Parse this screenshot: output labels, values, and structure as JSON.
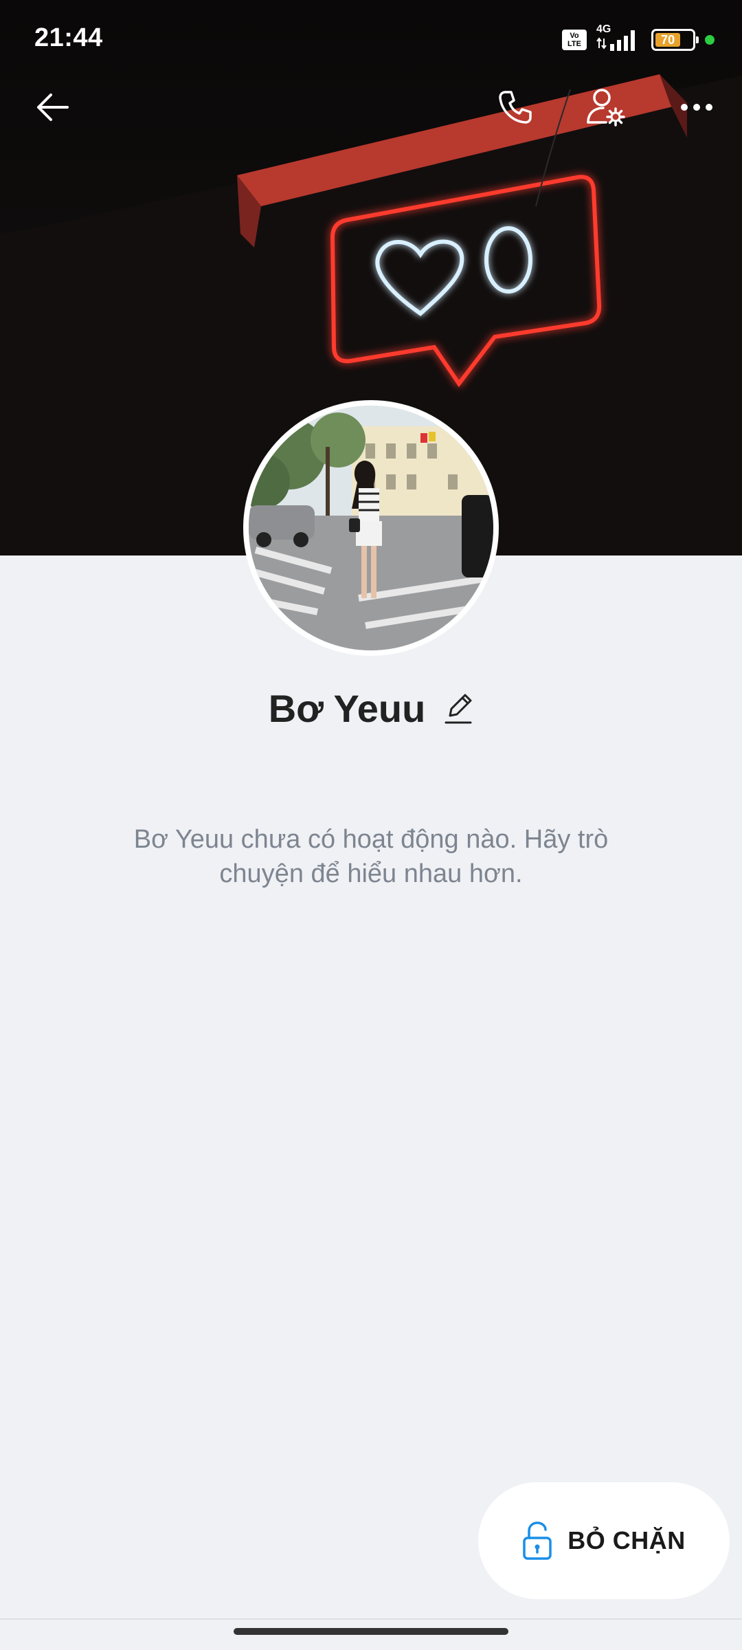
{
  "status_bar": {
    "time": "21:44",
    "volte_top": "Vo",
    "volte_bottom": "LTE",
    "network": "4G",
    "battery_level": "70",
    "battery_fraction": 0.7,
    "icons": [
      "volte-icon",
      "signal-icon",
      "battery-icon",
      "privacy-dot-icon"
    ]
  },
  "nav": {
    "back_icon": "arrow-left-icon",
    "call_icon": "phone-icon",
    "settings_icon": "user-settings-icon",
    "more_icon": "more-dots-icon"
  },
  "profile": {
    "name": "Bơ Yeuu",
    "edit_icon": "pencil-icon"
  },
  "activity": {
    "empty_message": "Bơ Yeuu chưa có hoạt động nào. Hãy trò chuyện để hiểu nhau hơn."
  },
  "actions": {
    "unblock_label": "BỎ CHẶN",
    "unblock_icon": "unlock-icon"
  },
  "colors": {
    "page_bg": "#f0f1f5",
    "cover_bg": "#050505",
    "neon_red": "#ff3b2f",
    "neon_white": "#d8f0ff",
    "accent_blue": "#1a8ee8",
    "muted_text": "#7d8590"
  }
}
